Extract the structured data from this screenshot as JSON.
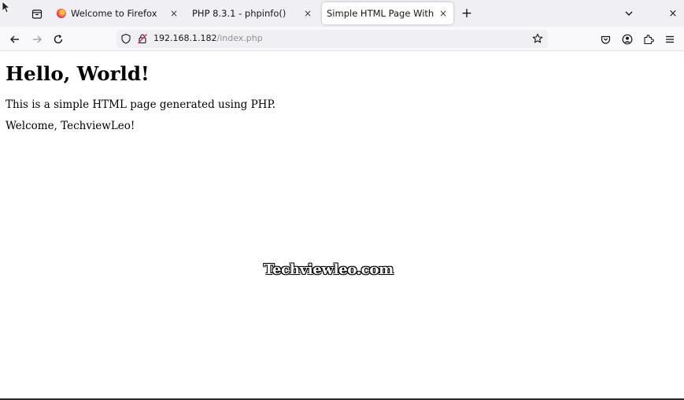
{
  "tabs": [
    {
      "title": "Welcome to Firefox",
      "favicon": "firefox-icon",
      "close": "×",
      "active": false
    },
    {
      "title": "PHP 8.3.1 - phpinfo()",
      "favicon": "",
      "close": "×",
      "active": false
    },
    {
      "title": "Simple HTML Page With PHP",
      "favicon": "",
      "close": "×",
      "active": true
    }
  ],
  "tabbar": {
    "new_tab": "+",
    "window_close": "×"
  },
  "urlbar": {
    "host": "192.168.1.182",
    "path": "/index.php"
  },
  "page": {
    "heading": "Hello, World!",
    "paragraph1": "This is a simple HTML page generated using PHP.",
    "paragraph2": "Welcome, TechviewLeo!"
  },
  "watermark": "Techviewleo.com",
  "colors": {
    "tabbar_bg": "#f0f0f4",
    "toolbar_bg": "#f9f9fb",
    "urlbar_bg": "#f0f0f4",
    "text": "#15141a",
    "url_path": "#8f8f9d"
  }
}
